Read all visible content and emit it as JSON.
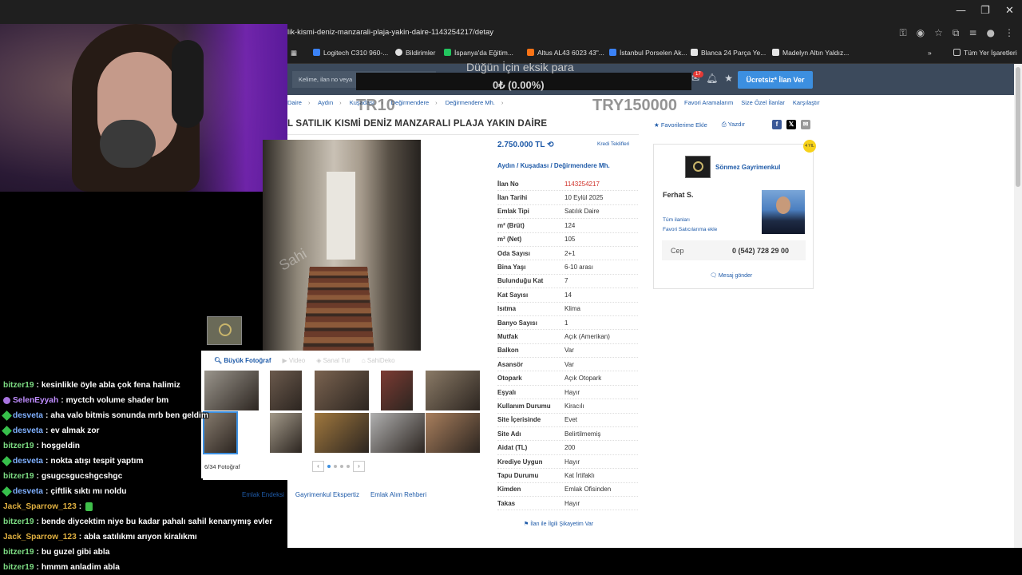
{
  "browser": {
    "url": "lik-kismi-deniz-manzarali-plaja-yakin-daire-1143254217/detay",
    "window_controls": [
      "—",
      "❐",
      "✕"
    ],
    "bookmarks": [
      {
        "label": "Logitech C310 960-...",
        "color": "#3b82f6"
      },
      {
        "label": "Bildirimler",
        "color": "#e0e0e0"
      },
      {
        "label": "İspanya'da Eğitim...",
        "color": "#22c55e"
      },
      {
        "label": "Altus AL43 6023 43\"...",
        "color": "#f97316"
      },
      {
        "label": "İstanbul Porselen Ak...",
        "color": "#3b82f6"
      },
      {
        "label": "Blanca 24 Parça Ye...",
        "color": "#e5e5e5"
      },
      {
        "label": "Madelyn Altın Yaldız...",
        "color": "#e5e5e5"
      }
    ],
    "more_bookmarks": "»",
    "all_bookmarks": "Tüm Yer İşaretleri"
  },
  "site_header": {
    "search_placeholder": "Kelime, ilan no veya",
    "notification_count": "17",
    "post_button": "Ücretsiz* İlan Ver"
  },
  "donation": {
    "title": "Düğün İçin eksik para",
    "value": "0₺ (0.00%)",
    "left_overlay": "TR10",
    "right_overlay": "TRY150000"
  },
  "breadcrumb": [
    "Daire",
    "Aydın",
    "Kuşadası",
    "Değirmendere",
    "Değirmendere Mh."
  ],
  "tabs_right": [
    "Favori Aramalarım",
    "Size Özel İlanlar",
    "Karşılaştır"
  ],
  "listing": {
    "title": "L SATILIK KISMİ DENİZ MANZARALI PLAJA YAKIN DAİRE",
    "favorite": "Favorilerime Ekle",
    "print": "Yazdır",
    "price": "2.750.000 TL",
    "credit_offers": "Kredi Teklifleri",
    "location": [
      "Aydın",
      "Kuşadası",
      "Değirmendere Mh."
    ],
    "location_sep": "/",
    "specs": [
      {
        "label": "İlan No",
        "value": "1143254217",
        "highlight": true
      },
      {
        "label": "İlan Tarihi",
        "value": "10 Eylül 2025"
      },
      {
        "label": "Emlak Tipi",
        "value": "Satılık Daire"
      },
      {
        "label": "m² (Brüt)",
        "value": "124"
      },
      {
        "label": "m² (Net)",
        "value": "105"
      },
      {
        "label": "Oda Sayısı",
        "value": "2+1"
      },
      {
        "label": "Bina Yaşı",
        "value": "6-10 arası"
      },
      {
        "label": "Bulunduğu Kat",
        "value": "7"
      },
      {
        "label": "Kat Sayısı",
        "value": "14"
      },
      {
        "label": "Isıtma",
        "value": "Klima"
      },
      {
        "label": "Banyo Sayısı",
        "value": "1"
      },
      {
        "label": "Mutfak",
        "value": "Açık (Amerikan)"
      },
      {
        "label": "Balkon",
        "value": "Var"
      },
      {
        "label": "Asansör",
        "value": "Var"
      },
      {
        "label": "Otopark",
        "value": "Açık Otopark"
      },
      {
        "label": "Eşyalı",
        "value": "Hayır"
      },
      {
        "label": "Kullanım Durumu",
        "value": "Kiracılı"
      },
      {
        "label": "Site İçerisinde",
        "value": "Evet"
      },
      {
        "label": "Site Adı",
        "value": "Belirtilmemiş"
      },
      {
        "label": "Aidat (TL)",
        "value": "200"
      },
      {
        "label": "Krediye Uygun",
        "value": "Hayır"
      },
      {
        "label": "Tapu Durumu",
        "value": "Kat İrtifaklı"
      },
      {
        "label": "Kimden",
        "value": "Emlak Ofisinden"
      },
      {
        "label": "Takas",
        "value": "Hayır"
      }
    ],
    "complaint": "İlan ile İlgili Şikayetim Var"
  },
  "photos": {
    "tabs": [
      "Büyük Fotoğraf",
      "Video",
      "Sanal Tur",
      "SahiDeko"
    ],
    "count": "6/34 Fotoğraf",
    "watermark": "Sahi",
    "thumb_colors": [
      "#9a958c",
      "#6b5a4d",
      "#7a6350",
      "#7c3b33",
      "#8a7a66",
      "#857a6d",
      "#a39a8a",
      "#a0783e",
      "#b0b0b0",
      "#a97f5d"
    ]
  },
  "bottom_links": [
    "Emlak Endeksi",
    "Gayrimenkul Ekspertiz",
    "Emlak Alım Rehberi"
  ],
  "seller": {
    "company": "Sönmez Gayrimenkul",
    "agent": "Ferhat S.",
    "all_listings": "Tüm ilanları",
    "add_favorite": "Favori Satıcılarıma ekle",
    "phone_label": "Cep",
    "phone": "0 (542) 728 29 00",
    "message": "Mesaj gönder",
    "badge": "4 YIL"
  },
  "chat": [
    {
      "user": "bitzer19",
      "color": "#7ddc83",
      "badge": "",
      "text": "kesinlikle öyle abla çok fena halimiz"
    },
    {
      "user": "SelenEyyah",
      "color": "#c08dff",
      "badge": "purple",
      "text": "myctch volume shader bm"
    },
    {
      "user": "desveta",
      "color": "#7fb0ff",
      "badge": "green",
      "text": "aha valo bitmis sonunda mrb ben geldim"
    },
    {
      "user": "desveta",
      "color": "#7fb0ff",
      "badge": "green",
      "text": "ev almak zor"
    },
    {
      "user": "bitzer19",
      "color": "#7ddc83",
      "badge": "",
      "text": "hoşgeldin"
    },
    {
      "user": "desveta",
      "color": "#7fb0ff",
      "badge": "green",
      "text": "nokta atışı tespit yaptım"
    },
    {
      "user": "bitzer19",
      "color": "#7ddc83",
      "badge": "",
      "text": "gsugcsgucshgcshgc"
    },
    {
      "user": "desveta",
      "color": "#7fb0ff",
      "badge": "green",
      "text": "çiftlik sıktı mı noldu"
    },
    {
      "user": "Jack_Sparrow_123",
      "color": "#e0b040",
      "badge": "",
      "text": "",
      "emote": true
    },
    {
      "user": "bitzer19",
      "color": "#7ddc83",
      "badge": "",
      "text": "bende diycektim niye bu kadar pahalı sahil kenarıymış evler"
    },
    {
      "user": "Jack_Sparrow_123",
      "color": "#e0b040",
      "badge": "",
      "text": "abla satılıkmı arıyon kiralıkmı"
    },
    {
      "user": "bitzer19",
      "color": "#7ddc83",
      "badge": "",
      "text": "bu guzel gibi abla"
    },
    {
      "user": "bitzer19",
      "color": "#7ddc83",
      "badge": "",
      "text": "hmmm anladim abla"
    }
  ]
}
